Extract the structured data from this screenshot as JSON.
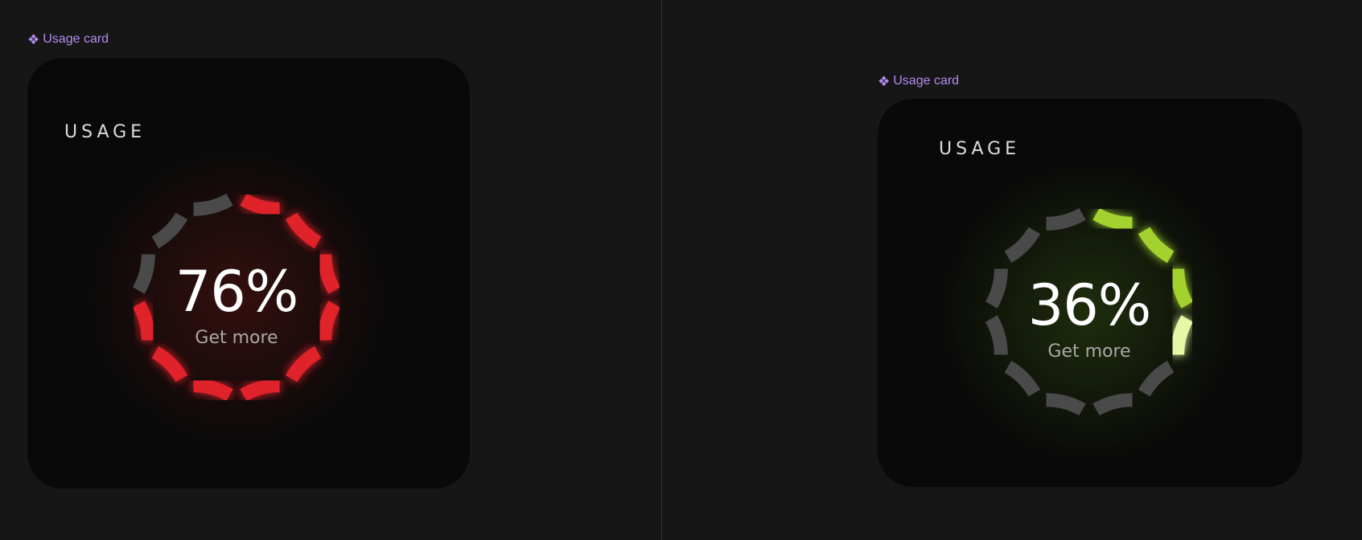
{
  "cards": [
    {
      "frame_label": "Usage card",
      "title": "USAGE",
      "percent_text": "76%",
      "usage_fraction": 0.76,
      "cta": "Get more",
      "colors": {
        "active": "#e0222b",
        "inactive": "#4a4a4a",
        "glow": "#ff2a2a",
        "tip": "#e0222b"
      }
    },
    {
      "frame_label": "Usage card",
      "title": "USAGE",
      "percent_text": "36%",
      "usage_fraction": 0.36,
      "cta": "Get more",
      "colors": {
        "active": "#a3d22e",
        "inactive": "#4a4a4a",
        "glow": "#7fd01a",
        "tip": "#e8f7a6"
      }
    }
  ]
}
